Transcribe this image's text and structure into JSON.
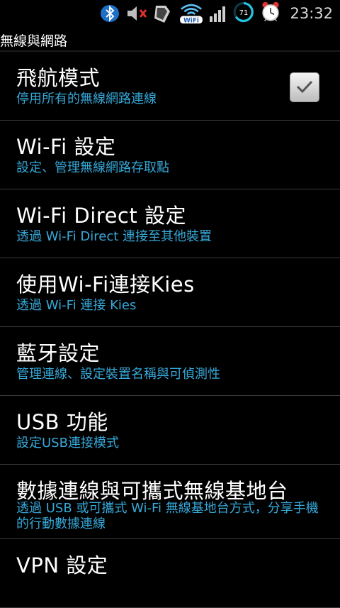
{
  "status_bar": {
    "time": "23:32",
    "battery_level": "71",
    "icons": [
      "bluetooth-icon",
      "mute-icon",
      "sd-card-icon",
      "wifi-icon",
      "signal-icon",
      "battery-icon",
      "alarm-icon"
    ],
    "colors": {
      "accent": "#36a9d9"
    }
  },
  "page": {
    "title": "無線與網路"
  },
  "items": [
    {
      "title": "飛航模式",
      "subtitle": "停用所有的無線網路連線",
      "checked": true
    },
    {
      "title": "Wi-Fi 設定",
      "subtitle": "設定、管理無線網路存取點"
    },
    {
      "title": "Wi-Fi Direct 設定",
      "subtitle": "透過 Wi-Fi Direct 連接至其他裝置"
    },
    {
      "title": "使用Wi-Fi連接Kies",
      "subtitle": "透過 Wi-Fi 連接 Kies"
    },
    {
      "title": "藍牙設定",
      "subtitle": "管理連線、設定裝置名稱與可偵測性"
    },
    {
      "title": "USB 功能",
      "subtitle": "設定USB連接模式"
    },
    {
      "title": "數據連線與可攜式無線基地台",
      "subtitle": "透過 USB 或可攜式 Wi-Fi 無線基地台方式，分享手機的行動數據連線"
    },
    {
      "title": "VPN 設定"
    }
  ]
}
